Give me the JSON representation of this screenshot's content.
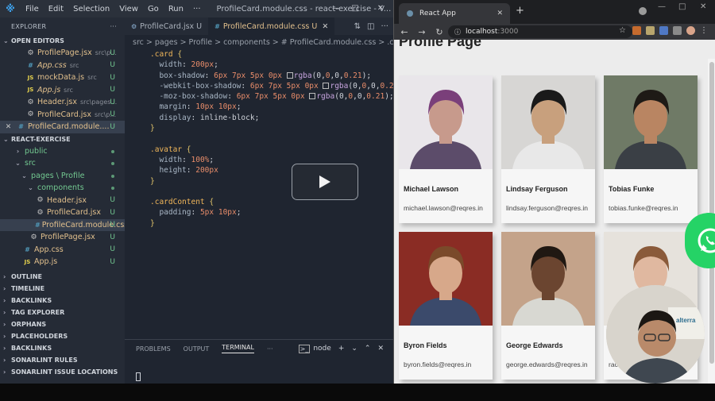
{
  "vscode": {
    "menu": [
      "File",
      "Edit",
      "Selection",
      "View",
      "Go",
      "Run",
      "···"
    ],
    "window_title": "ProfileCard.module.css - react-exercise - V...",
    "explorer_title": "EXPLORER",
    "open_editors_title": "OPEN EDITORS",
    "open_editors": [
      {
        "name": "ProfilePage.jsx",
        "path": "src\\p...",
        "icon": "gear-icon",
        "badge": "U"
      },
      {
        "name": "App.css",
        "path": "src",
        "icon": "css-icon",
        "badge": "U"
      },
      {
        "name": "mockData.js",
        "path": "src",
        "icon": "js-icon",
        "badge": "U"
      },
      {
        "name": "App.js",
        "path": "src",
        "icon": "js-icon",
        "badge": "U"
      },
      {
        "name": "Header.jsx",
        "path": "src\\pages...",
        "icon": "gear-icon",
        "badge": "U"
      },
      {
        "name": "ProfileCard.jsx",
        "path": "src\\p...",
        "icon": "gear-icon",
        "badge": "U"
      },
      {
        "name": "ProfileCard.module....",
        "path": "",
        "icon": "css-icon",
        "badge": "U"
      }
    ],
    "project_title": "REACT-EXERCISE",
    "tree": [
      {
        "name": "public",
        "depth": 1,
        "folder": true,
        "badge": "dot"
      },
      {
        "name": "src",
        "depth": 1,
        "folder": true,
        "badge": "dot"
      },
      {
        "name": "pages \\ Profile",
        "depth": 2,
        "folder": true,
        "badge": "dot"
      },
      {
        "name": "components",
        "depth": 3,
        "folder": true,
        "badge": "dot"
      },
      {
        "name": "Header.jsx",
        "depth": 4,
        "icon": "gear-icon",
        "badge": "U"
      },
      {
        "name": "ProfileCard.jsx",
        "depth": 4,
        "icon": "gear-icon",
        "badge": "U"
      },
      {
        "name": "ProfileCard.module.css",
        "depth": 4,
        "icon": "css-icon",
        "badge": "U"
      },
      {
        "name": "ProfilePage.jsx",
        "depth": 3,
        "icon": "gear-icon",
        "badge": "U"
      },
      {
        "name": "App.css",
        "depth": 2,
        "icon": "css-icon",
        "badge": "U"
      },
      {
        "name": "App.js",
        "depth": 2,
        "icon": "js-icon",
        "badge": "U"
      }
    ],
    "collapsed_sections": [
      "OUTLINE",
      "TIMELINE",
      "BACKLINKS",
      "TAG EXPLORER",
      "ORPHANS",
      "PLACEHOLDERS",
      "BACKLINKS",
      "SONARLINT RULES",
      "SONARLINT ISSUE LOCATIONS"
    ],
    "tabs": [
      {
        "label": "ProfileCard.jsx U",
        "active": false
      },
      {
        "label": "ProfileCard.module.css U",
        "active": true
      }
    ],
    "breadcrumb": "src > pages > Profile > components > # ProfileCard.module.css > .card",
    "code_lines": [
      ".card {",
      "  width: 200px;",
      "  box-shadow: 6px 7px 5px 0px rgba(0,0,0,0.21);",
      "  -webkit-box-shadow: 6px 7px 5px 0px rgba(0,0,0,0.21);",
      "  -moz-box-shadow: 6px 7px 5px 0px rgba(0,0,0,0.21);",
      "  margin: 10px 10px;",
      "  display: inline-block;",
      "}",
      "",
      ".avatar {",
      "  width: 100%;",
      "  height: 200px",
      "}",
      "",
      ".cardContent {",
      "  padding: 5px 10px;",
      "}"
    ],
    "panel_tabs": [
      "PROBLEMS",
      "OUTPUT",
      "TERMINAL",
      "···"
    ],
    "terminal_label": "node",
    "player_icon": "play-icon"
  },
  "browser": {
    "tab_title": "React App",
    "url_host": "localhost",
    "url_port": ":3000",
    "page_title": "Profile Page",
    "profiles": [
      {
        "name": "Michael Lawson",
        "email": "michael.lawson@reqres.in",
        "photo": "portrait-photo-michael"
      },
      {
        "name": "Lindsay Ferguson",
        "email": "lindsay.ferguson@reqres.in",
        "photo": "portrait-photo-lindsay"
      },
      {
        "name": "Tobias Funke",
        "email": "tobias.funke@reqres.in",
        "photo": "portrait-photo-tobias"
      },
      {
        "name": "Byron Fields",
        "email": "byron.fields@reqres.in",
        "photo": "portrait-photo-byron"
      },
      {
        "name": "George Edwards",
        "email": "george.edwards@reqres.in",
        "photo": "portrait-photo-george"
      },
      {
        "name": "",
        "email": "rac",
        "photo": "portrait-photo-rachel"
      }
    ],
    "webcam_caption": "alterra"
  },
  "colors": {
    "accent": "#3ea4f0",
    "whatsapp": "#25d366",
    "untracked": "#73c991",
    "modified_name": "#e2c08d"
  }
}
